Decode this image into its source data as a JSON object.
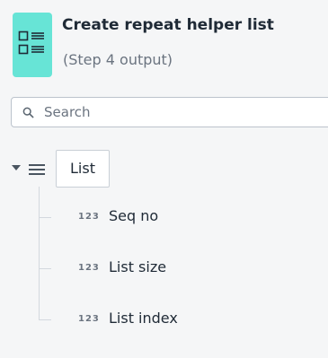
{
  "header": {
    "title": "Create repeat helper list",
    "subtitle": "(Step 4 output)",
    "icon": "checklist-icon",
    "icon_color": "#67e4d6"
  },
  "search": {
    "placeholder": "Search",
    "value": ""
  },
  "tree": {
    "root": {
      "label": "List",
      "icon": "list-icon",
      "expanded": true
    },
    "children": [
      {
        "type_badge": "123",
        "label": "Seq no"
      },
      {
        "type_badge": "123",
        "label": "List size"
      },
      {
        "type_badge": "123",
        "label": "List index"
      }
    ]
  }
}
